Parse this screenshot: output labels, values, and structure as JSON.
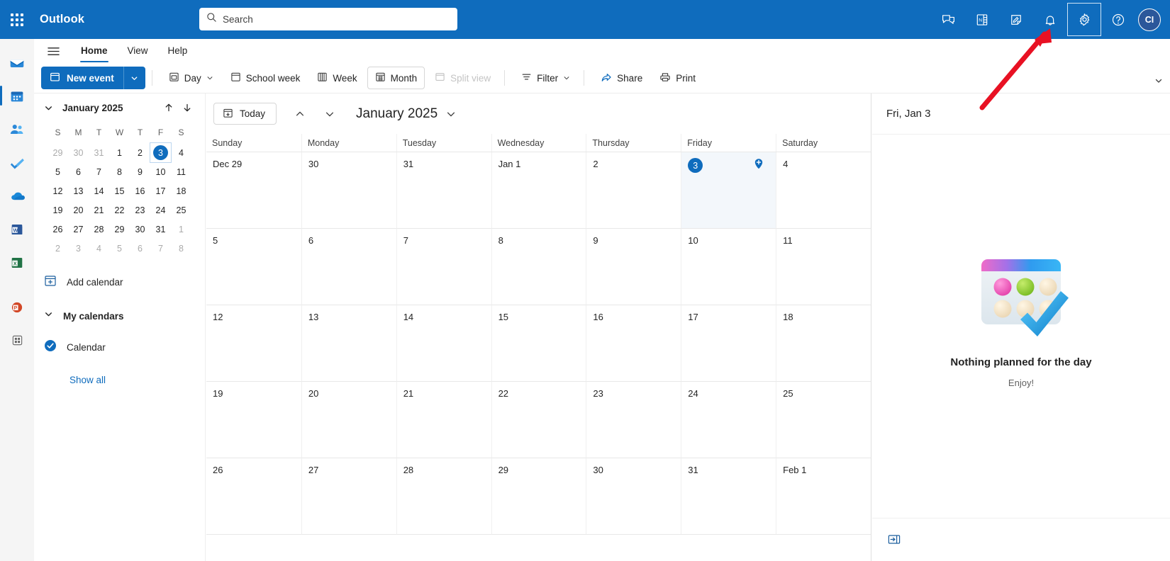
{
  "topbar": {
    "brand": "Outlook",
    "waffle_name": "app-launcher",
    "search_placeholder": "Search",
    "search_value": "",
    "actions": [
      {
        "name": "teams-chat-icon",
        "label": "Teams chat"
      },
      {
        "name": "onenote-icon",
        "label": "OneNote feed"
      },
      {
        "name": "notes-icon",
        "label": "Notes"
      },
      {
        "name": "notifications-bell-icon",
        "label": "Notifications"
      },
      {
        "name": "settings-gear-icon",
        "label": "Settings"
      },
      {
        "name": "help-icon",
        "label": "Help"
      }
    ],
    "avatar_initials": "CI"
  },
  "rail": {
    "items": [
      {
        "name": "mail",
        "label": "Mail",
        "selected": false
      },
      {
        "name": "calendar",
        "label": "Calendar",
        "selected": true
      },
      {
        "name": "people",
        "label": "People",
        "selected": false
      },
      {
        "name": "to-do",
        "label": "To Do",
        "selected": false
      },
      {
        "name": "onedrive",
        "label": "OneDrive",
        "selected": false
      },
      {
        "name": "word",
        "label": "Word",
        "selected": false
      },
      {
        "name": "excel",
        "label": "Excel",
        "selected": false
      },
      {
        "name": "powerpoint",
        "label": "PowerPoint",
        "selected": false
      },
      {
        "name": "more-apps",
        "label": "More apps",
        "selected": false
      }
    ]
  },
  "ribbon": {
    "tabs": [
      {
        "label": "Home",
        "active": true
      },
      {
        "label": "View",
        "active": false
      },
      {
        "label": "Help",
        "active": false
      }
    ],
    "new_event": "New event",
    "commands": [
      {
        "label": "Day",
        "icon": "day-view-icon",
        "selected": false,
        "disabled": false,
        "caret": true
      },
      {
        "label": "School week",
        "icon": "school-week-icon",
        "selected": false,
        "disabled": false,
        "caret": false
      },
      {
        "label": "Week",
        "icon": "week-view-icon",
        "selected": false,
        "disabled": false,
        "caret": false
      },
      {
        "label": "Month",
        "icon": "month-view-icon",
        "selected": true,
        "disabled": false,
        "caret": false
      },
      {
        "label": "Split view",
        "icon": "split-view-icon",
        "selected": false,
        "disabled": true,
        "caret": false
      },
      {
        "label": "Filter",
        "icon": "filter-icon",
        "selected": false,
        "disabled": false,
        "caret": true
      },
      {
        "label": "Share",
        "icon": "share-icon",
        "selected": false,
        "disabled": false,
        "caret": false
      },
      {
        "label": "Print",
        "icon": "print-icon",
        "selected": false,
        "disabled": false,
        "caret": false
      }
    ]
  },
  "left_pane": {
    "mini_calendar": {
      "title": "January 2025",
      "dow": [
        "S",
        "M",
        "T",
        "W",
        "T",
        "F",
        "S"
      ],
      "weeks": [
        [
          {
            "d": "29",
            "out": true
          },
          {
            "d": "30",
            "out": true
          },
          {
            "d": "31",
            "out": true
          },
          {
            "d": "1",
            "out": false
          },
          {
            "d": "2",
            "out": false
          },
          {
            "d": "3",
            "out": false,
            "today": true
          },
          {
            "d": "4",
            "out": false
          }
        ],
        [
          {
            "d": "5"
          },
          {
            "d": "6"
          },
          {
            "d": "7"
          },
          {
            "d": "8"
          },
          {
            "d": "9"
          },
          {
            "d": "10"
          },
          {
            "d": "11"
          }
        ],
        [
          {
            "d": "12"
          },
          {
            "d": "13"
          },
          {
            "d": "14"
          },
          {
            "d": "15"
          },
          {
            "d": "16"
          },
          {
            "d": "17"
          },
          {
            "d": "18"
          }
        ],
        [
          {
            "d": "19"
          },
          {
            "d": "20"
          },
          {
            "d": "21"
          },
          {
            "d": "22"
          },
          {
            "d": "23"
          },
          {
            "d": "24"
          },
          {
            "d": "25"
          }
        ],
        [
          {
            "d": "26"
          },
          {
            "d": "27"
          },
          {
            "d": "28"
          },
          {
            "d": "29"
          },
          {
            "d": "30"
          },
          {
            "d": "31"
          },
          {
            "d": "1",
            "out": true
          }
        ],
        [
          {
            "d": "2",
            "out": true
          },
          {
            "d": "3",
            "out": true
          },
          {
            "d": "4",
            "out": true
          },
          {
            "d": "5",
            "out": true
          },
          {
            "d": "6",
            "out": true
          },
          {
            "d": "7",
            "out": true
          },
          {
            "d": "8",
            "out": true
          }
        ]
      ]
    },
    "add_calendar": "Add calendar",
    "my_calendars": "My calendars",
    "calendar_item": "Calendar",
    "show_all": "Show all"
  },
  "calendar": {
    "today_button": "Today",
    "title": "January 2025",
    "day_headers": [
      "Sunday",
      "Monday",
      "Tuesday",
      "Wednesday",
      "Thursday",
      "Friday",
      "Saturday"
    ],
    "weeks": [
      [
        {
          "label": "Dec 29"
        },
        {
          "label": "30"
        },
        {
          "label": "31"
        },
        {
          "label": "Jan 1"
        },
        {
          "label": "2"
        },
        {
          "label": "3",
          "today": true,
          "add": true
        },
        {
          "label": "4"
        }
      ],
      [
        {
          "label": "5"
        },
        {
          "label": "6"
        },
        {
          "label": "7"
        },
        {
          "label": "8"
        },
        {
          "label": "9"
        },
        {
          "label": "10"
        },
        {
          "label": "11"
        }
      ],
      [
        {
          "label": "12"
        },
        {
          "label": "13"
        },
        {
          "label": "14"
        },
        {
          "label": "15"
        },
        {
          "label": "16"
        },
        {
          "label": "17"
        },
        {
          "label": "18"
        }
      ],
      [
        {
          "label": "19"
        },
        {
          "label": "20"
        },
        {
          "label": "21"
        },
        {
          "label": "22"
        },
        {
          "label": "23"
        },
        {
          "label": "24"
        },
        {
          "label": "25"
        }
      ],
      [
        {
          "label": "26"
        },
        {
          "label": "27"
        },
        {
          "label": "28"
        },
        {
          "label": "29"
        },
        {
          "label": "30"
        },
        {
          "label": "31"
        },
        {
          "label": "Feb 1"
        }
      ]
    ]
  },
  "agenda": {
    "header": "Fri, Jan 3",
    "empty_title": "Nothing planned for the day",
    "empty_subtitle": "Enjoy!",
    "collapse_icon": "collapse-pane-icon"
  },
  "annotation": {
    "arrow_color": "#E81123",
    "points_to": "settings-gear-icon"
  },
  "colors": {
    "brand_blue": "#0F6CBD",
    "topbar_blue": "#0F6CBD",
    "today_highlight": "#F3F7FB",
    "accent_link": "#0F6CBD"
  }
}
